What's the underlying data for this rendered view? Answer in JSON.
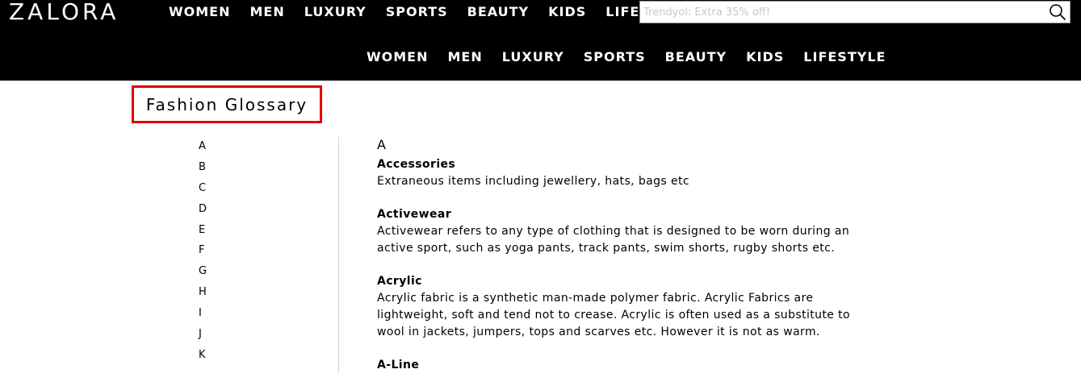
{
  "header": {
    "logo": "ZALORA",
    "top_nav": [
      "WOMEN",
      "MEN",
      "LUXURY",
      "SPORTS",
      "BEAUTY",
      "KIDS",
      "LIFESTYLE"
    ],
    "sub_nav": [
      "WOMEN",
      "MEN",
      "LUXURY",
      "SPORTS",
      "BEAUTY",
      "KIDS",
      "LIFESTYLE"
    ],
    "search": {
      "placeholder": "Trendyol: Extra 35% off!",
      "value": "",
      "icon": "search-icon"
    }
  },
  "page": {
    "title": "Fashion Glossary",
    "highlight_color": "#e00000"
  },
  "letters": [
    "A",
    "B",
    "C",
    "D",
    "E",
    "F",
    "G",
    "H",
    "I",
    "J",
    "K"
  ],
  "glossary": {
    "section_letter": "A",
    "terms": [
      {
        "name": "Accessories",
        "definition": "Extraneous items including jewellery, hats, bags etc"
      },
      {
        "name": "Activewear",
        "definition": "Activewear refers to any type of clothing that is designed to be worn during an active sport, such as yoga pants, track pants, swim shorts, rugby shorts etc."
      },
      {
        "name": "Acrylic",
        "definition": "Acrylic fabric is a synthetic man-made polymer fabric. Acrylic Fabrics are lightweight, soft and tend not to crease. Acrylic is often used as a substitute to wool in jackets, jumpers, tops and scarves etc. However it is not as warm."
      },
      {
        "name": "A-Line",
        "definition": ""
      }
    ]
  }
}
